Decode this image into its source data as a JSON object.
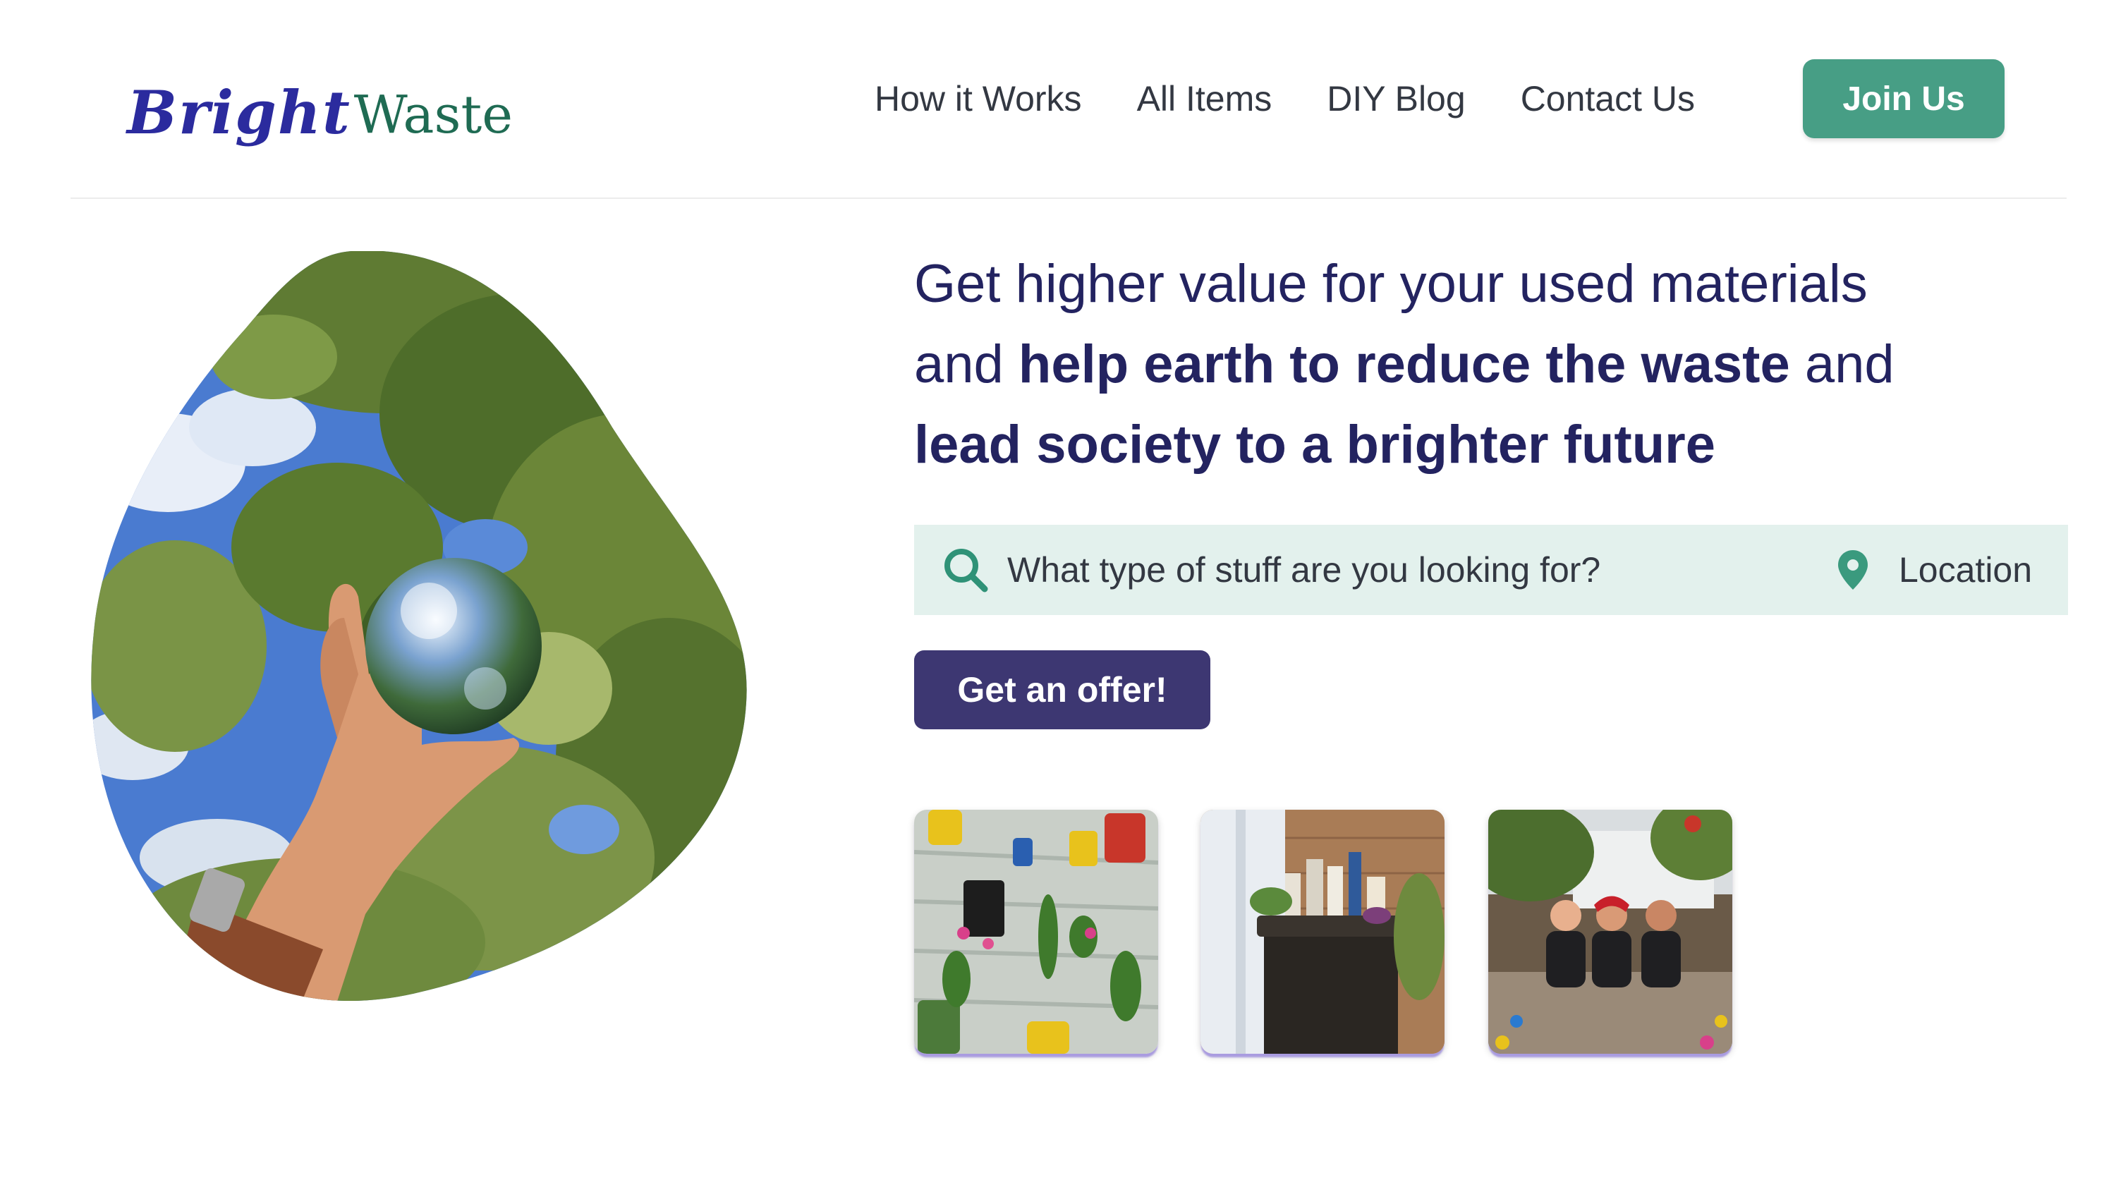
{
  "header": {
    "logo": {
      "part1": "Bright",
      "part2": "Waste"
    },
    "nav": [
      {
        "label": "How it Works"
      },
      {
        "label": "All Items"
      },
      {
        "label": "DIY Blog"
      },
      {
        "label": "Contact Us"
      }
    ],
    "join_label": "Join Us"
  },
  "hero": {
    "headline": {
      "line1": "Get higher value for your used materials",
      "line2_pre": "and ",
      "line2_bold": "help earth to reduce the waste",
      "line2_post": " and",
      "line3_bold": "lead society to a brighter future"
    },
    "search": {
      "icon": "search-icon",
      "placeholder": "What type of stuff are you looking for?",
      "location_icon": "map-pin-icon",
      "location_placeholder": "Location"
    },
    "offer_label": "Get an offer!",
    "image": "hand-holding-crystal-ball-photo"
  },
  "thumbnails": [
    {
      "name": "hanging-can-planters-photo"
    },
    {
      "name": "recycling-bin-photo"
    },
    {
      "name": "volunteers-group-photo"
    }
  ],
  "colors": {
    "brand_purple": "#232360",
    "accent_green": "#479e85",
    "button_purple": "#3d3772",
    "search_bg": "#e3f1ed"
  }
}
